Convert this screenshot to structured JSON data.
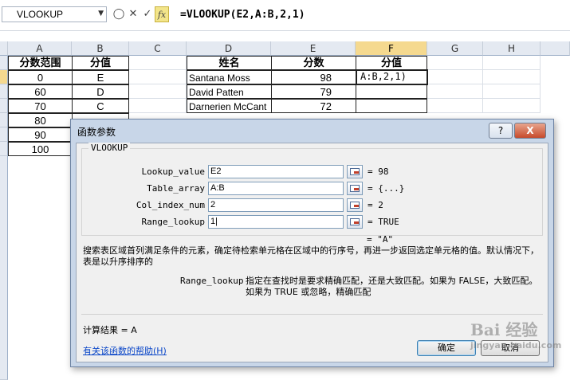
{
  "formula_bar": {
    "name_box": "VLOOKUP",
    "fx_label": "fx",
    "formula": "=VLOOKUP(E2,A:B,2,1)"
  },
  "columns": [
    "A",
    "B",
    "C",
    "D",
    "E",
    "F",
    "G",
    "H"
  ],
  "sheet": {
    "score_table_headers": [
      "分数范围",
      "分值"
    ],
    "score_table": [
      [
        "0",
        "E"
      ],
      [
        "60",
        "D"
      ],
      [
        "70",
        "C"
      ],
      [
        "80",
        ""
      ],
      [
        "90",
        ""
      ],
      [
        "100",
        ""
      ]
    ],
    "name_table_headers": [
      "姓名",
      "分数",
      "分值"
    ],
    "name_table": [
      [
        "Santana Moss",
        "98"
      ],
      [
        "David Patten",
        "79"
      ],
      [
        "Darnerien McCant",
        "72"
      ]
    ],
    "active_cell_text": "A:B,2,1)"
  },
  "dialog": {
    "title": "函数参数",
    "help_button": "?",
    "close_button": "X",
    "function_name": "VLOOKUP",
    "args": [
      {
        "label": "Lookup_value",
        "value": "E2",
        "result": "98"
      },
      {
        "label": "Table_array",
        "value": "A:B",
        "result": "{...}"
      },
      {
        "label": "Col_index_num",
        "value": "2",
        "result": "2"
      },
      {
        "label": "Range_lookup",
        "value": "1|",
        "result": "TRUE"
      }
    ],
    "equals": "=",
    "formula_result_preview": "\"A\"",
    "description": "搜索表区域首列满足条件的元素，确定待检索单元格在区域中的行序号，再进一步返回选定单元格的值。默认情况下，表是以升序排序的",
    "arg_desc_name": "Range_lookup",
    "arg_desc_text": "指定在查找时是要求精确匹配，还是大致匹配。如果为 FALSE，大致匹配。如果为 TRUE 或忽略，精确匹配",
    "result_label": "计算结果 =",
    "result_value": "A",
    "help_link": "有关该函数的帮助(H)",
    "ok_button": "确定",
    "cancel_button": "取消"
  },
  "watermark": {
    "line1": "Bai 经验",
    "line2": "jingyan.baidu.com"
  },
  "colors": {
    "fx_button": "#f3e58a",
    "header_bg": "#e4e9f1",
    "selected_header": "#f5d98f",
    "dialog_frame": "#c8d6e8",
    "link": "#0a46c8"
  }
}
